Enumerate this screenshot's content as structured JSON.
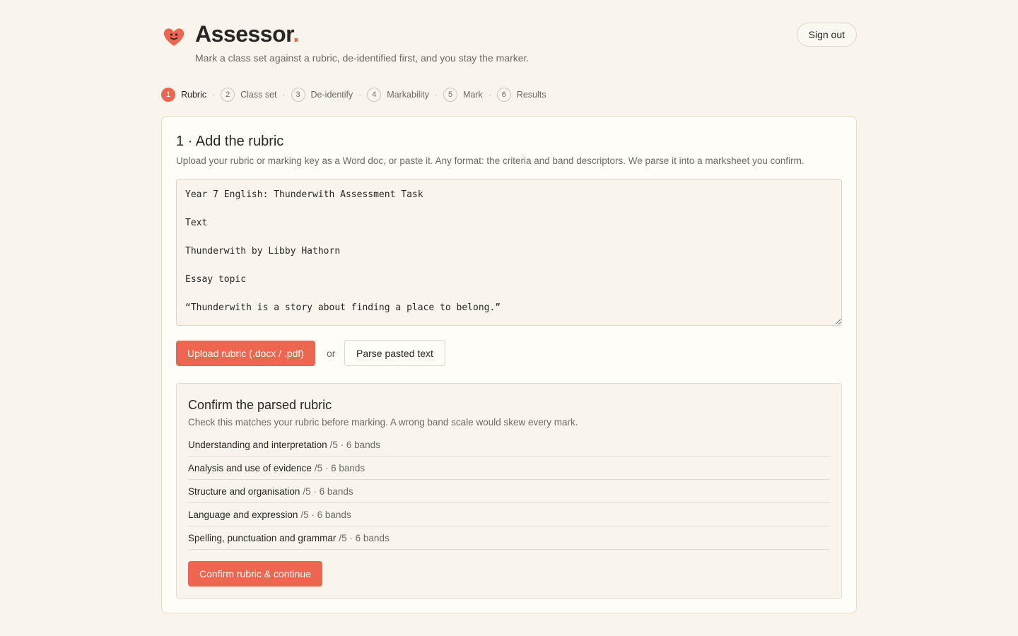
{
  "app": {
    "name": "Assessor",
    "name_dot": ".",
    "tagline": "Mark a class set against a rubric, de-identified first, and you stay the marker.",
    "sign_out_label": "Sign out",
    "logo_icon": "smiling-heart-icon",
    "accent_color": "#ef6650"
  },
  "steps": [
    {
      "number": "1",
      "label": "Rubric",
      "active": true
    },
    {
      "number": "2",
      "label": "Class set",
      "active": false
    },
    {
      "number": "3",
      "label": "De-identify",
      "active": false
    },
    {
      "number": "4",
      "label": "Markability",
      "active": false
    },
    {
      "number": "5",
      "label": "Mark",
      "active": false
    },
    {
      "number": "6",
      "label": "Results",
      "active": false
    }
  ],
  "step_separator": "·",
  "rubric_step": {
    "title": "1 · Add the rubric",
    "description": "Upload your rubric or marking key as a Word doc, or paste it. Any format: the criteria and band descriptors. We parse it into a marksheet you confirm.",
    "textarea_value": "Year 7 English: Thunderwith Assessment Task\n\nText\n\nThunderwith by Libby Hathorn\n\nEssay topic\n\n“Thunderwith is a story about finding a place to belong.”",
    "upload_label": "Upload rubric (.docx / .pdf)",
    "or_label": "or",
    "parse_label": "Parse pasted text"
  },
  "confirm": {
    "title": "Confirm the parsed rubric",
    "subtitle": "Check this matches your rubric before marking. A wrong band scale would skew every mark.",
    "criteria": [
      {
        "name": "Understanding and interpretation",
        "meta": "/5 · 6 bands"
      },
      {
        "name": "Analysis and use of evidence",
        "meta": "/5 · 6 bands"
      },
      {
        "name": "Structure and organisation",
        "meta": "/5 · 6 bands"
      },
      {
        "name": "Language and expression",
        "meta": "/5 · 6 bands"
      },
      {
        "name": "Spelling, punctuation and grammar",
        "meta": "/5 · 6 bands"
      }
    ],
    "continue_label": "Confirm rubric & continue"
  }
}
